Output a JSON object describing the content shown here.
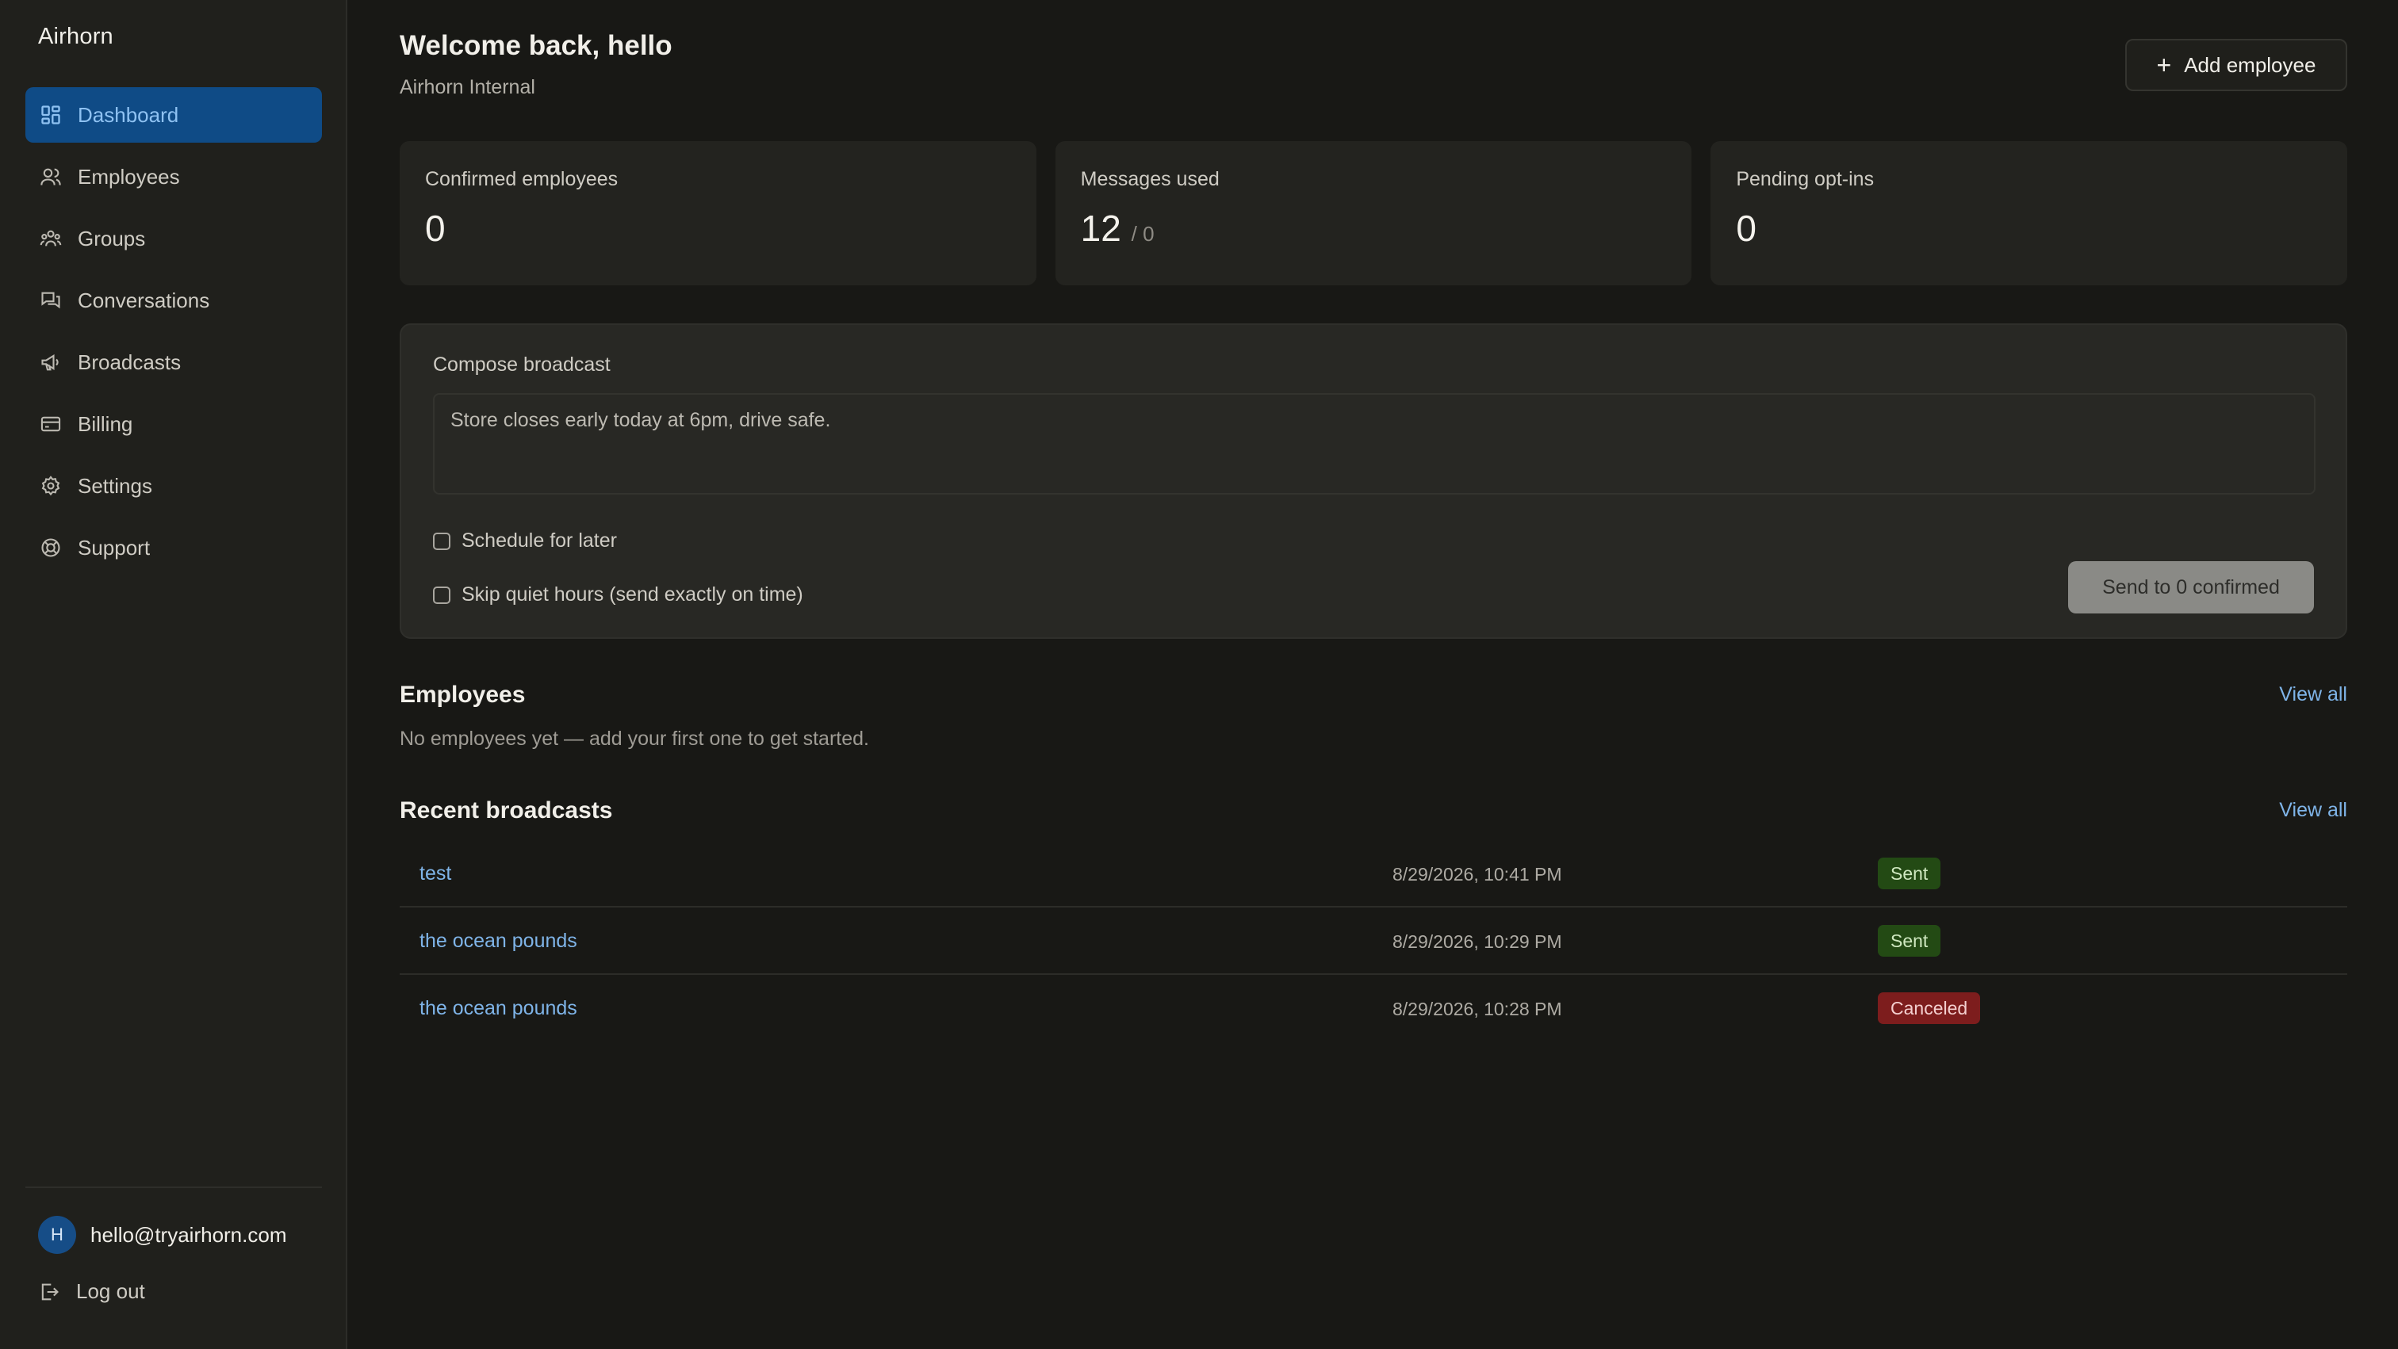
{
  "app": {
    "brand": "Airhorn"
  },
  "sidebar": {
    "items": [
      {
        "label": "Dashboard",
        "icon": "dashboard-icon",
        "active": true
      },
      {
        "label": "Employees",
        "icon": "users-icon"
      },
      {
        "label": "Groups",
        "icon": "group-icon"
      },
      {
        "label": "Conversations",
        "icon": "chat-icon"
      },
      {
        "label": "Broadcasts",
        "icon": "megaphone-icon"
      },
      {
        "label": "Billing",
        "icon": "credit-card-icon"
      },
      {
        "label": "Settings",
        "icon": "gear-icon"
      },
      {
        "label": "Support",
        "icon": "lifebuoy-icon"
      }
    ],
    "user": {
      "initial": "H",
      "email": "hello@tryairhorn.com"
    },
    "logout_label": "Log out"
  },
  "header": {
    "welcome": "Welcome back, hello",
    "org": "Airhorn Internal",
    "add_employee_label": "Add employee"
  },
  "stats": {
    "confirmed": {
      "label": "Confirmed employees",
      "value": "0"
    },
    "messages": {
      "label": "Messages used",
      "value": "12",
      "limit": "/ 0"
    },
    "pending": {
      "label": "Pending opt-ins",
      "value": "0"
    }
  },
  "compose": {
    "title": "Compose broadcast",
    "message": "Store closes early today at 6pm, drive safe.",
    "schedule_label": "Schedule for later",
    "skip_quiet_label": "Skip quiet hours (send exactly on time)",
    "send_label": "Send to 0 confirmed"
  },
  "employees": {
    "title": "Employees",
    "view_all": "View all",
    "empty": "No employees yet — add your first one to get started."
  },
  "broadcasts": {
    "title": "Recent broadcasts",
    "view_all": "View all",
    "rows": [
      {
        "name": "test",
        "date": "8/29/2026, 10:41 PM",
        "status": "Sent"
      },
      {
        "name": "the ocean pounds",
        "date": "8/29/2026, 10:29 PM",
        "status": "Sent"
      },
      {
        "name": "the ocean pounds",
        "date": "8/29/2026, 10:28 PM",
        "status": "Canceled"
      }
    ]
  },
  "colors": {
    "active_nav_bg": "#0f4b86",
    "link": "#7fb4e8",
    "sent_badge": "#234a14",
    "canceled_badge": "#7d1d1d"
  }
}
